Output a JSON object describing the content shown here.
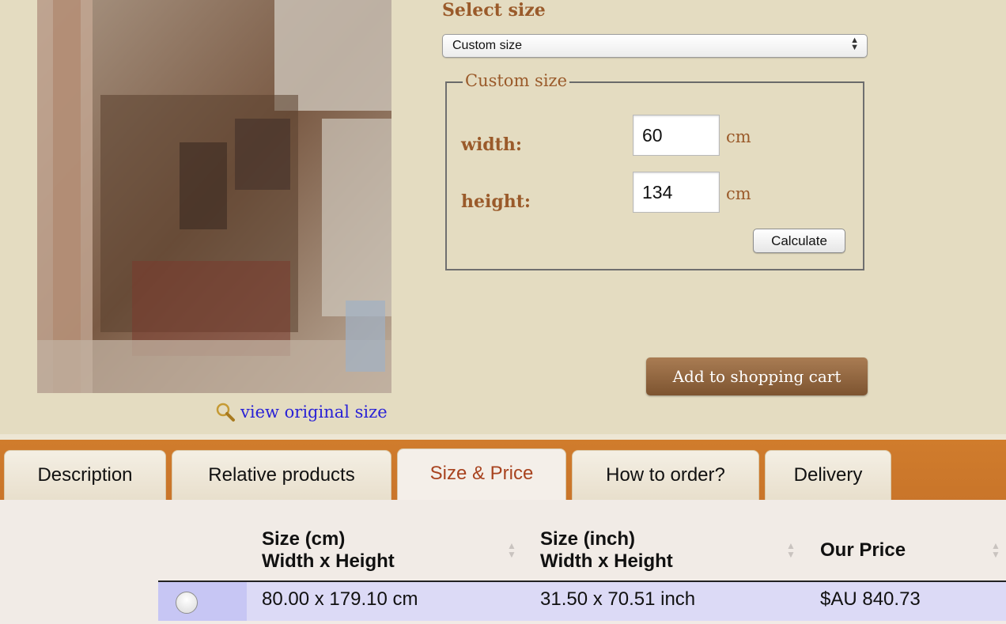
{
  "painting": {
    "view_original_label": "view original size"
  },
  "size_selector": {
    "title": "Select size",
    "selected": "Custom size"
  },
  "custom_size": {
    "legend": "Custom size",
    "width_label": "width:",
    "width_value": "60",
    "height_label": "height:",
    "height_value": "134",
    "unit": "cm",
    "calculate_label": "Calculate"
  },
  "cart": {
    "add_label": "Add to shopping cart"
  },
  "tabs": [
    {
      "label": "Description",
      "active": false
    },
    {
      "label": "Relative products",
      "active": false
    },
    {
      "label": "Size & Price",
      "active": true
    },
    {
      "label": "How to order?",
      "active": false
    },
    {
      "label": "Delivery",
      "active": false
    }
  ],
  "price_table": {
    "columns": [
      {
        "line1": "Size (cm)",
        "line2": "Width x Height"
      },
      {
        "line1": "Size (inch)",
        "line2": "Width x Height"
      },
      {
        "line1": "Our Price",
        "line2": ""
      }
    ],
    "rows": [
      {
        "size_cm": "80.00 x 179.10 cm",
        "size_inch": "31.50 x 70.51 inch",
        "price": "$AU 840.73",
        "selected": false
      }
    ]
  },
  "colors": {
    "page_bg": "#e4dcc1",
    "label_brown": "#9a5a2a",
    "tab_band_orange": "#d07c2c",
    "active_tab_text": "#a8431f",
    "row_highlight": "#dcdaf6",
    "link_blue": "#2a22d6"
  }
}
